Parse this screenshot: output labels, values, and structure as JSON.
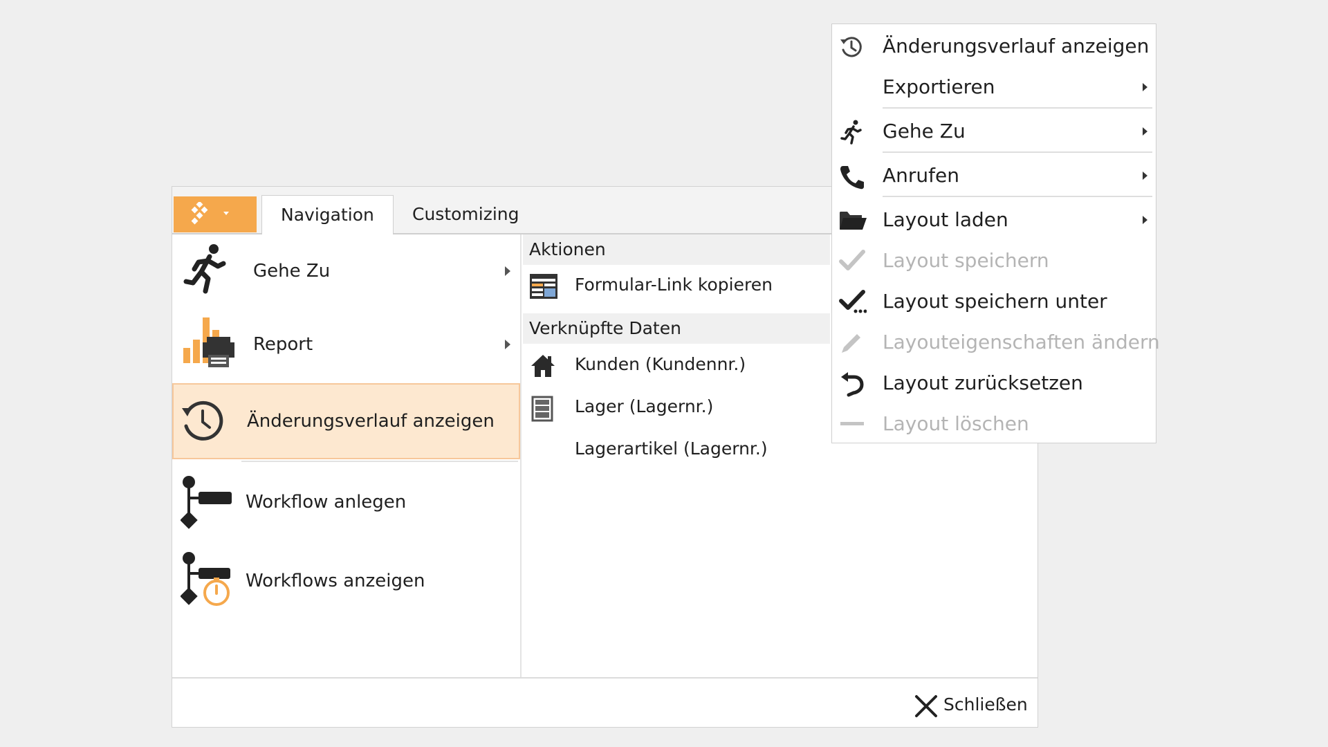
{
  "ribbon": {
    "tabs": [
      {
        "label": "Navigation",
        "active": true
      },
      {
        "label": "Customizing",
        "active": false
      }
    ]
  },
  "left_menu": {
    "items": [
      {
        "label": "Gehe Zu",
        "icon": "running-man-icon",
        "has_submenu": true
      },
      {
        "label": "Report",
        "icon": "report-printer-icon",
        "has_submenu": true
      },
      {
        "label": "Änderungsverlauf anzeigen",
        "icon": "history-clock-icon",
        "selected": true
      },
      {
        "label": "Workflow anlegen",
        "icon": "workflow-icon"
      },
      {
        "label": "Workflows anzeigen",
        "icon": "workflow-timer-icon"
      }
    ]
  },
  "right_panel": {
    "actions_header": "Aktionen",
    "actions": [
      {
        "label": "Formular-Link kopieren",
        "icon": "form-link-icon"
      }
    ],
    "linked_header": "Verknüpfte Daten",
    "linked": [
      {
        "label": "Kunden (Kundennr.)",
        "icon": "house-icon"
      },
      {
        "label": "Lager (Lagernr.)",
        "icon": "warehouse-icon"
      },
      {
        "label": "Lagerartikel (Lagernr.)",
        "icon": ""
      }
    ]
  },
  "footer": {
    "close_label": "Schließen"
  },
  "context_menu": {
    "items": [
      {
        "label": "Änderungsverlauf anzeigen",
        "icon": "history-icon",
        "enabled": true,
        "submenu": false
      },
      {
        "label": "Exportieren",
        "icon": "",
        "enabled": true,
        "submenu": true
      },
      {
        "label": "Gehe Zu",
        "icon": "running-man-icon",
        "enabled": true,
        "submenu": true
      },
      {
        "label": "Anrufen",
        "icon": "phone-icon",
        "enabled": true,
        "submenu": true
      },
      {
        "label": "Layout laden",
        "icon": "folder-open-icon",
        "enabled": true,
        "submenu": true
      },
      {
        "label": "Layout speichern",
        "icon": "checkmark-icon",
        "enabled": false,
        "submenu": false
      },
      {
        "label": "Layout speichern unter",
        "icon": "checkmark-dots-icon",
        "enabled": true,
        "submenu": false
      },
      {
        "label": "Layouteigenschaften ändern",
        "icon": "pencil-icon",
        "enabled": false,
        "submenu": false
      },
      {
        "label": "Layout zurücksetzen",
        "icon": "undo-icon",
        "enabled": true,
        "submenu": false
      },
      {
        "label": "Layout löschen",
        "icon": "minus-icon",
        "enabled": false,
        "submenu": false
      }
    ]
  },
  "colors": {
    "accent": "#f5a84c",
    "selected_bg": "#fde8d0",
    "disabled_text": "#b4b4b4"
  }
}
